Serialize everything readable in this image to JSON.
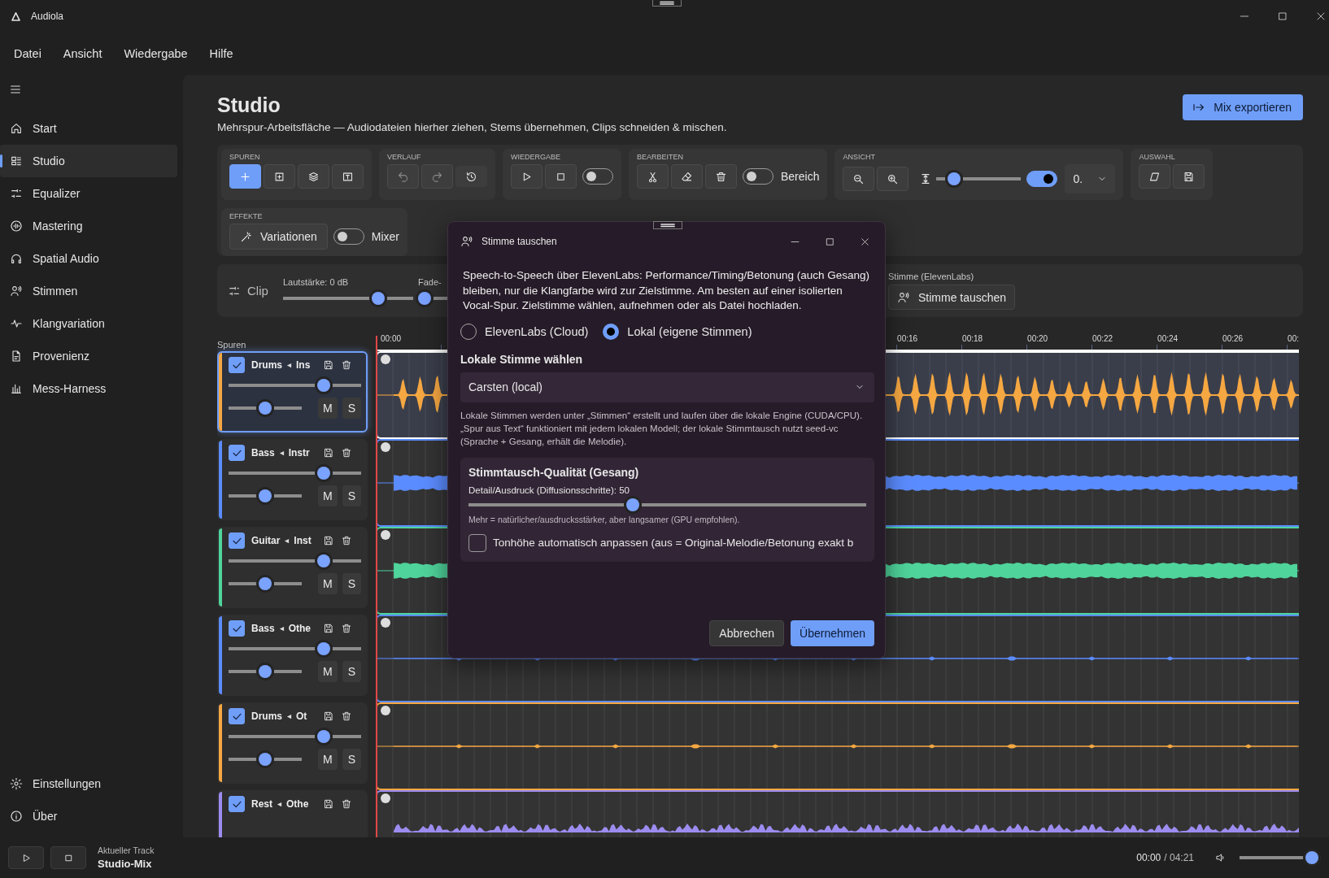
{
  "app": {
    "title": "Audiola"
  },
  "menu": [
    "Datei",
    "Ansicht",
    "Wiedergabe",
    "Hilfe"
  ],
  "sidebar": {
    "items": [
      {
        "kind": "home",
        "label": "Start",
        "selected": false
      },
      {
        "kind": "studio",
        "label": "Studio",
        "selected": true
      },
      {
        "kind": "equalizer",
        "label": "Equalizer",
        "selected": false
      },
      {
        "kind": "mastering",
        "label": "Mastering",
        "selected": false
      },
      {
        "kind": "spatial",
        "label": "Spatial Audio",
        "selected": false
      },
      {
        "kind": "voices",
        "label": "Stimmen",
        "selected": false
      },
      {
        "kind": "variation",
        "label": "Klangvariation",
        "selected": false
      },
      {
        "kind": "provenance",
        "label": "Provenienz",
        "selected": false
      },
      {
        "kind": "measure",
        "label": "Mess-Harness",
        "selected": false
      }
    ],
    "footer": [
      {
        "kind": "settings",
        "label": "Einstellungen",
        "selected": false
      },
      {
        "kind": "about",
        "label": "Über",
        "selected": false
      }
    ]
  },
  "page": {
    "title": "Studio",
    "subtitle": "Mehrspur-Arbeitsfläche — Audiodateien hierher ziehen, Stems übernehmen, Clips schneiden & mischen.",
    "export_button": "Mix exportieren"
  },
  "toolbar": {
    "groups": [
      {
        "kind": "tracks",
        "title": "SPUREN"
      },
      {
        "kind": "history",
        "title": "VERLAUF",
        "undo_disabled": true,
        "redo_disabled": true
      },
      {
        "kind": "playback",
        "title": "WIEDERGABE",
        "loop_on": false
      },
      {
        "kind": "edit",
        "title": "BEARBEITEN",
        "range_on": false,
        "range_label": "Bereich"
      },
      {
        "kind": "view",
        "title": "ANSICHT",
        "height": {
          "level": 0.15
        },
        "wave_on": true,
        "zoom_value": "0."
      },
      {
        "kind": "selection",
        "title": "AUSWAHL"
      },
      {
        "kind": "effects",
        "title": "EFFEKTE",
        "variations_label": "Variationen",
        "mixer_on": false,
        "mixer_label": "Mixer"
      }
    ]
  },
  "clip": {
    "label": "Clip",
    "volume_label": "Lautstärke: 0 dB",
    "volume": {
      "level": 0.76
    },
    "fade_label": "Fade-",
    "fade": {
      "level": 0.0
    },
    "voice_label": "Stimme (ElevenLabs)",
    "voice_button": "Stimme tauschen"
  },
  "tracks": {
    "label": "Spuren",
    "ruler": {
      "start": "00:00",
      "ticks": [
        "00:16",
        "00:18",
        "00:20",
        "00:22",
        "00:24",
        "00:26",
        "00:"
      ]
    },
    "items": [
      {
        "name": "Drums",
        "source": "Ins",
        "color": "#f5a742",
        "selected": true,
        "checked": true,
        "volume": {
          "level": 0.74
        },
        "pan": {
          "level": 0.5
        },
        "mute_label": "M",
        "solo_label": "S",
        "kind": "spiky"
      },
      {
        "name": "Bass",
        "source": "Instr",
        "color": "#5b8cff",
        "selected": false,
        "checked": true,
        "volume": {
          "level": 0.74
        },
        "pan": {
          "level": 0.5
        },
        "mute_label": "M",
        "solo_label": "S",
        "kind": "band"
      },
      {
        "name": "Guitar",
        "source": "Inst",
        "color": "#4fd49b",
        "selected": false,
        "checked": true,
        "volume": {
          "level": 0.74
        },
        "pan": {
          "level": 0.5
        },
        "mute_label": "M",
        "solo_label": "S",
        "kind": "band"
      },
      {
        "name": "Bass",
        "source": "Othe",
        "color": "#5b8cff",
        "selected": false,
        "checked": true,
        "volume": {
          "level": 0.74
        },
        "pan": {
          "level": 0.5
        },
        "mute_label": "M",
        "solo_label": "S",
        "kind": "flat"
      },
      {
        "name": "Drums",
        "source": "Ot",
        "color": "#f5a742",
        "selected": false,
        "checked": true,
        "volume": {
          "level": 0.74
        },
        "pan": {
          "level": 0.5
        },
        "mute_label": "M",
        "solo_label": "S",
        "kind": "flat"
      },
      {
        "name": "Rest",
        "source": "Othe",
        "color": "#9c8cf0",
        "selected": false,
        "checked": true,
        "kind": "low"
      }
    ]
  },
  "dialog": {
    "title": "Stimme tauschen",
    "description": "Speech-to-Speech über ElevenLabs: Performance/Timing/Betonung (auch Gesang) bleiben, nur die Klangfarbe wird zur Zielstimme. Am besten auf einer isolierten Vocal-Spur. Zielstimme wählen, aufnehmen oder als Datei hochladen.",
    "engines": [
      {
        "label": "ElevenLabs (Cloud)",
        "selected": false
      },
      {
        "label": "Lokal (eigene Stimmen)",
        "selected": true
      }
    ],
    "voice_heading": "Lokale Stimme wählen",
    "voice_value": "Carsten (local)",
    "voice_help": "Lokale Stimmen werden unter „Stimmen“ erstellt und laufen über die lokale Engine (CUDA/CPU). „Spur aus Text“ funktioniert mit jedem lokalen Modell; der lokale Stimmtausch nutzt seed-vc (Sprache + Gesang, erhält die Melodie).",
    "quality": {
      "title": "Stimmtausch-Qualität (Gesang)",
      "detail_label": "Detail/Ausdruck (Diffusionsschritte): 50",
      "detail": {
        "level": 0.41
      },
      "hint": "Mehr = natürlicher/ausdrucksstärker, aber langsamer (GPU empfohlen).",
      "pitch_label": "Tonhöhe automatisch anpassen (aus = Original-Melodie/Betonung exakt b",
      "pitch_checked": false
    },
    "cancel": "Abbrechen",
    "apply": "Übernehmen"
  },
  "player": {
    "caption": "Aktueller Track",
    "track": "Studio-Mix",
    "position": "00:00",
    "duration": "/ 04:21",
    "volume": {
      "level": 0.97
    }
  }
}
